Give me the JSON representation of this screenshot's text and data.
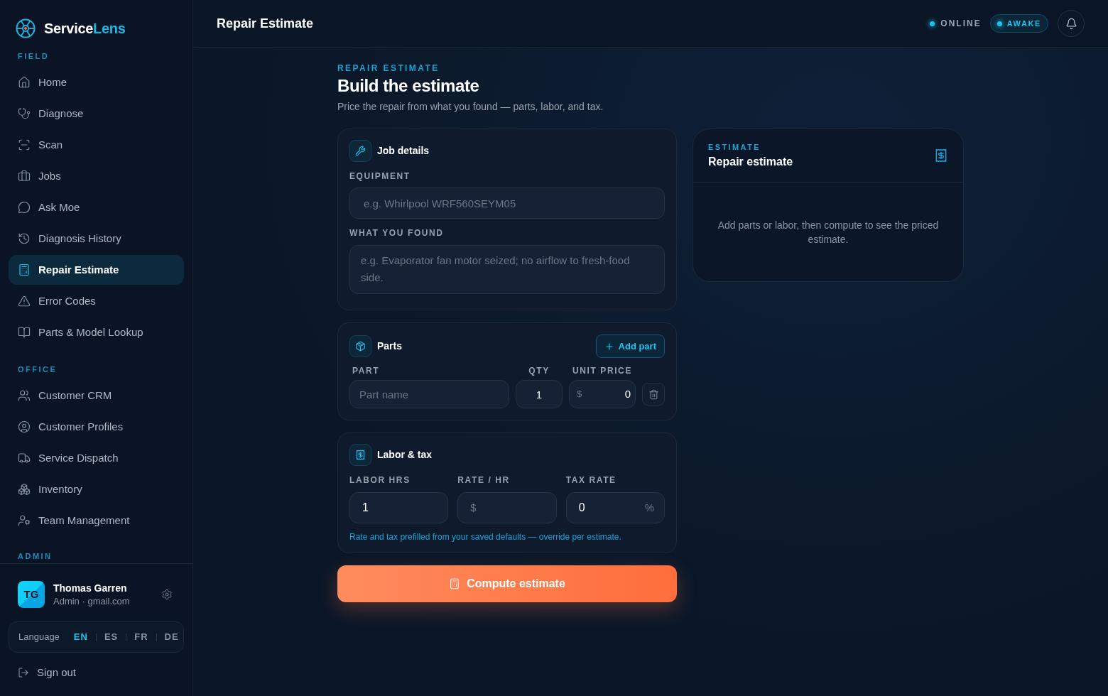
{
  "sidebar": {
    "brand": {
      "primary": "Service",
      "accent": "Lens"
    },
    "sections": [
      {
        "title": "FIELD",
        "items": [
          {
            "label": "Home",
            "selected": false
          },
          {
            "label": "Diagnose",
            "selected": false
          },
          {
            "label": "Scan",
            "selected": false
          },
          {
            "label": "Jobs",
            "selected": false
          },
          {
            "label": "Ask Moe",
            "selected": false
          },
          {
            "label": "Diagnosis History",
            "selected": false
          },
          {
            "label": "Repair Estimate",
            "selected": true
          },
          {
            "label": "Error Codes",
            "selected": false
          },
          {
            "label": "Parts & Model Lookup",
            "selected": false
          }
        ]
      },
      {
        "title": "OFFICE",
        "items": [
          {
            "label": "Customer CRM",
            "selected": false
          },
          {
            "label": "Customer Profiles",
            "selected": false
          },
          {
            "label": "Service Dispatch",
            "selected": false
          },
          {
            "label": "Inventory",
            "selected": false
          },
          {
            "label": "Team Management",
            "selected": false
          }
        ]
      },
      {
        "title": "ADMIN"
      }
    ],
    "user": {
      "initials": "TG",
      "name": "Thomas Garren",
      "subtitle": "Admin · gmail.com"
    },
    "language": {
      "label": "Language",
      "options": [
        {
          "label": "EN",
          "selected": true
        },
        {
          "label": "ES",
          "selected": false
        },
        {
          "label": "FR",
          "selected": false
        },
        {
          "label": "DE",
          "selected": false
        }
      ]
    },
    "sign_out": "Sign out"
  },
  "header": {
    "title": "Repair Estimate",
    "status": [
      {
        "label": "ONLINE",
        "kind": "plain"
      },
      {
        "label": "AWAKE",
        "kind": "pill"
      }
    ]
  },
  "page": {
    "kicker": "REPAIR ESTIMATE",
    "title": "Build the estimate",
    "subtitle": "Price the repair from what you found — parts, labor, and tax."
  },
  "job_details": {
    "title": "Job details",
    "fields": [
      {
        "label": "EQUIPMENT",
        "kind": "input",
        "placeholder": "e.g. Whirlpool WRF560SEYM05"
      },
      {
        "label": "WHAT YOU FOUND",
        "kind": "textarea",
        "placeholder": "e.g. Evaporator fan motor seized; no airflow to fresh-food side."
      }
    ]
  },
  "parts": {
    "title": "Parts",
    "add_button": "Add part",
    "columns": [
      "PART",
      "QTY",
      "UNIT PRICE"
    ],
    "rows": [
      {
        "part": {
          "placeholder": "Part name"
        },
        "qty": "1",
        "unit_price": {
          "prefix": "$",
          "value": "0"
        }
      }
    ]
  },
  "labor_tax": {
    "title": "Labor & tax",
    "fields": [
      {
        "label": "LABOR HRS",
        "value": "1"
      },
      {
        "label": "RATE / HR",
        "prefix": "$"
      },
      {
        "label": "TAX RATE",
        "value": "0",
        "suffix": "%"
      }
    ],
    "note": "Rate and tax prefilled from your saved defaults — override per estimate."
  },
  "compute_button": "Compute estimate",
  "estimate": {
    "kicker": "ESTIMATE",
    "title": "Repair estimate",
    "empty_message": "Add parts or labor, then compute to see the priced estimate."
  }
}
